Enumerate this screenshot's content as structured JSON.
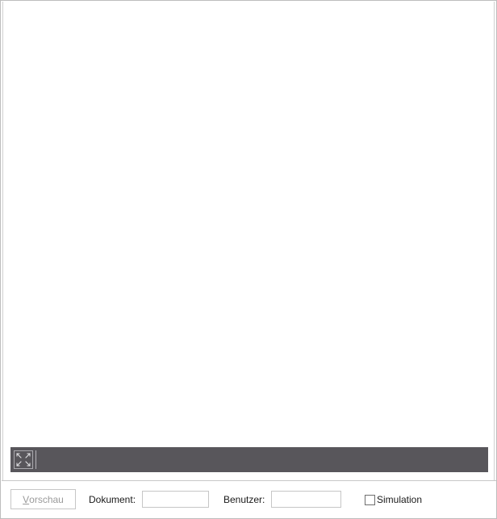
{
  "preview_toolbar": {
    "fullscreen_icon": "expand-arrows-icon"
  },
  "bottom_bar": {
    "preview_button": {
      "mnemonic": "V",
      "rest": "orschau",
      "enabled": false
    },
    "document_label": "Dokument:",
    "document_value": "",
    "user_label": "Benutzer:",
    "user_value": "",
    "simulation_label": "Simulation",
    "simulation_checked": false
  }
}
